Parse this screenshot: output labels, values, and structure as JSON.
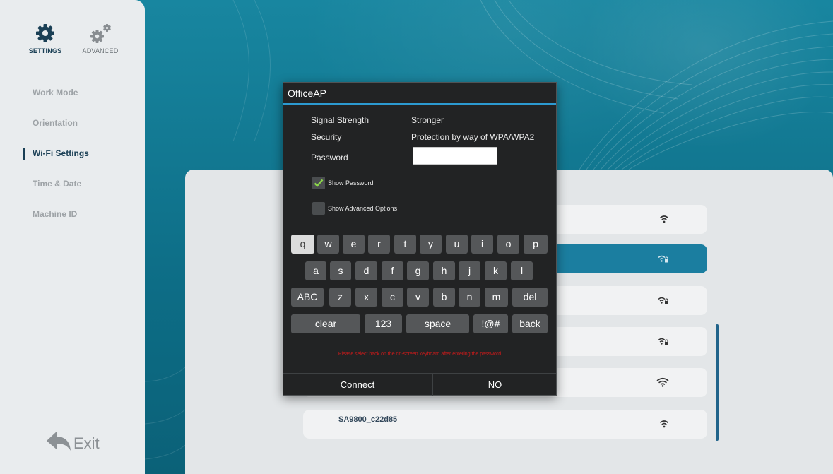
{
  "colors": {
    "accent": "#2c9ad1",
    "selected_row": "#1b7ea0",
    "warning": "#d11a1a",
    "nav_active": "#1a3f55"
  },
  "modes": {
    "settings": {
      "label": "SETTINGS",
      "icon": "gear-icon"
    },
    "advanced": {
      "label": "ADVANCED",
      "icon": "gears-icon"
    }
  },
  "sidebar": {
    "items": [
      {
        "label": "Work Mode"
      },
      {
        "label": "Orientation"
      },
      {
        "label": "Wi-Fi Settings",
        "active": true
      },
      {
        "label": "Time & Date"
      },
      {
        "label": "Machine ID"
      }
    ],
    "exit_label": "Exit"
  },
  "networks": {
    "rows": [
      {
        "name": "",
        "icon": "wifi-icon"
      },
      {
        "name": "",
        "icon": "wifi-lock-icon",
        "selected": true
      },
      {
        "name": "",
        "icon": "wifi-lock-icon"
      },
      {
        "name": "",
        "icon": "wifi-lock-icon"
      },
      {
        "name": "",
        "icon": "wifi-icon"
      },
      {
        "name": "SA9800_c22d85",
        "icon": "wifi-icon"
      }
    ]
  },
  "dialog": {
    "title": "OfficeAP",
    "signal_label": "Signal Strength",
    "signal_value": "Stronger",
    "security_label": "Security",
    "security_value": "Protection by way of WPA/WPA2",
    "password_label": "Password",
    "password_value": "",
    "show_password": {
      "label": "Show Password",
      "checked": true
    },
    "show_advanced": {
      "label": "Show Advanced Options",
      "checked": false
    },
    "keyboard": {
      "row1": [
        "q",
        "w",
        "e",
        "r",
        "t",
        "y",
        "u",
        "i",
        "o",
        "p"
      ],
      "row2": [
        "a",
        "s",
        "d",
        "f",
        "g",
        "h",
        "j",
        "k",
        "l"
      ],
      "row3": [
        "ABC",
        "z",
        "x",
        "c",
        "v",
        "b",
        "n",
        "m",
        "del"
      ],
      "row4": [
        "clear",
        "123",
        "space",
        "!@#",
        "back"
      ]
    },
    "note": "Please select back on the on-screen keyboard after entering the password",
    "connect_label": "Connect",
    "cancel_label": "NO"
  }
}
